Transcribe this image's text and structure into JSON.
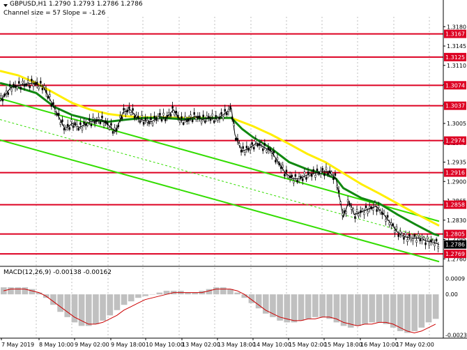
{
  "header": {
    "symbol_line": "GBPUSD,H1  1.2790 1.2793 1.2786 1.2786",
    "channel_line": "Channel size = 57 Slope = -1.26"
  },
  "colors": {
    "level_line": "#dd0022",
    "level_label_bg": "#dd0022",
    "price_label_bg": "#000000",
    "channel": "#33dd00",
    "ma_fast": "#118811",
    "ma_slow": "#ffee00",
    "candle": "#000000",
    "histogram": "#c0c0c0",
    "macd_signal": "#cc0000",
    "envelope": "#cc66cc"
  },
  "chart_data": {
    "type": "candlestick",
    "title": "GBPUSD,H1",
    "ylim": [
      1.2749,
      1.3198
    ],
    "y_ticks": [
      "1.3180",
      "1.3145",
      "1.3110",
      "1.3075",
      "1.3040",
      "1.3005",
      "1.2970",
      "1.2935",
      "1.2900",
      "1.2865",
      "1.2830",
      "1.2795",
      "1.2760"
    ],
    "x_labels": [
      "7 May 2019",
      "8 May 10:00",
      "9 May 02:00",
      "9 May 18:00",
      "10 May 10:00",
      "13 May 02:00",
      "13 May 18:00",
      "14 May 10:00",
      "15 May 02:00",
      "15 May 18:00",
      "16 May 10:00",
      "17 May 02:00"
    ],
    "levels": [
      {
        "value": 1.3167,
        "label": "1.3167"
      },
      {
        "value": 1.3125,
        "label": "1.3125"
      },
      {
        "value": 1.3074,
        "label": "1.3074"
      },
      {
        "value": 1.3037,
        "label": "1.3037"
      },
      {
        "value": 1.2974,
        "label": "1.2974"
      },
      {
        "value": 1.2916,
        "label": "1.2916"
      },
      {
        "value": 1.2858,
        "label": "1.2858"
      },
      {
        "value": 1.2805,
        "label": "1.2805"
      },
      {
        "value": 1.2769,
        "label": "1.2769"
      }
    ],
    "current_price": {
      "value": 1.2786,
      "label": "1.2786"
    },
    "price_path": [
      [
        0,
        1.3045
      ],
      [
        6,
        1.307
      ],
      [
        12,
        1.3075
      ],
      [
        18,
        1.3078
      ],
      [
        24,
        1.3072
      ],
      [
        29,
        1.304
      ],
      [
        32,
        1.302
      ],
      [
        36,
        1.2995
      ],
      [
        40,
        1.3005
      ],
      [
        44,
        1.2998
      ],
      [
        50,
        1.3008
      ],
      [
        56,
        1.3012
      ],
      [
        60,
        1.3002
      ],
      [
        64,
        1.299
      ],
      [
        68,
        1.3025
      ],
      [
        72,
        1.303
      ],
      [
        76,
        1.3015
      ],
      [
        80,
        1.301
      ],
      [
        84,
        1.3008
      ],
      [
        88,
        1.3018
      ],
      [
        92,
        1.3015
      ],
      [
        96,
        1.303
      ],
      [
        100,
        1.301
      ],
      [
        104,
        1.3012
      ],
      [
        108,
        1.3018
      ],
      [
        112,
        1.3012
      ],
      [
        116,
        1.3016
      ],
      [
        120,
        1.3013
      ],
      [
        124,
        1.3022
      ],
      [
        128,
        1.3032
      ],
      [
        130,
        1.2985
      ],
      [
        134,
        1.2955
      ],
      [
        138,
        1.296
      ],
      [
        142,
        1.297
      ],
      [
        146,
        1.2962
      ],
      [
        150,
        1.2955
      ],
      [
        154,
        1.2935
      ],
      [
        158,
        1.2915
      ],
      [
        162,
        1.2905
      ],
      [
        166,
        1.2905
      ],
      [
        170,
        1.2912
      ],
      [
        174,
        1.2915
      ],
      [
        178,
        1.2918
      ],
      [
        182,
        1.2918
      ],
      [
        186,
        1.2905
      ],
      [
        188,
        1.287
      ],
      [
        190,
        1.2835
      ],
      [
        193,
        1.2865
      ],
      [
        196,
        1.284
      ],
      [
        200,
        1.2845
      ],
      [
        204,
        1.285
      ],
      [
        208,
        1.2855
      ],
      [
        212,
        1.2842
      ],
      [
        216,
        1.2825
      ],
      [
        220,
        1.2808
      ],
      [
        224,
        1.28
      ],
      [
        228,
        1.2797
      ],
      [
        232,
        1.2798
      ],
      [
        236,
        1.2792
      ],
      [
        240,
        1.279
      ],
      [
        243,
        1.2786
      ]
    ],
    "ma_fast": [
      [
        0,
        1.3078
      ],
      [
        10,
        1.307
      ],
      [
        20,
        1.306
      ],
      [
        30,
        1.3035
      ],
      [
        40,
        1.302
      ],
      [
        50,
        1.3012
      ],
      [
        60,
        1.3008
      ],
      [
        70,
        1.3012
      ],
      [
        80,
        1.3015
      ],
      [
        90,
        1.3015
      ],
      [
        100,
        1.3013
      ],
      [
        110,
        1.3014
      ],
      [
        120,
        1.3015
      ],
      [
        128,
        1.3015
      ],
      [
        134,
        1.2995
      ],
      [
        140,
        1.298
      ],
      [
        150,
        1.296
      ],
      [
        160,
        1.2935
      ],
      [
        170,
        1.2922
      ],
      [
        180,
        1.2913
      ],
      [
        186,
        1.2905
      ],
      [
        190,
        1.2888
      ],
      [
        200,
        1.287
      ],
      [
        210,
        1.286
      ],
      [
        220,
        1.284
      ],
      [
        230,
        1.2822
      ],
      [
        240,
        1.2805
      ],
      [
        243,
        1.2802
      ]
    ],
    "ma_slow": [
      [
        0,
        1.31
      ],
      [
        10,
        1.3092
      ],
      [
        20,
        1.3078
      ],
      [
        30,
        1.306
      ],
      [
        40,
        1.3042
      ],
      [
        50,
        1.303
      ],
      [
        60,
        1.3022
      ],
      [
        70,
        1.3018
      ],
      [
        80,
        1.3016
      ],
      [
        90,
        1.3016
      ],
      [
        100,
        1.3015
      ],
      [
        110,
        1.3015
      ],
      [
        120,
        1.3015
      ],
      [
        128,
        1.3015
      ],
      [
        140,
        1.3
      ],
      [
        150,
        1.2985
      ],
      [
        160,
        1.2968
      ],
      [
        170,
        1.295
      ],
      [
        180,
        1.2935
      ],
      [
        190,
        1.2915
      ],
      [
        200,
        1.2895
      ],
      [
        210,
        1.2878
      ],
      [
        220,
        1.286
      ],
      [
        230,
        1.2842
      ],
      [
        243,
        1.282
      ]
    ],
    "channel_lines": [
      {
        "name": "upper",
        "points": [
          [
            0,
            1.305
          ],
          [
            243,
            1.2828
          ]
        ]
      },
      {
        "name": "lower",
        "points": [
          [
            0,
            1.2975
          ],
          [
            243,
            1.2755
          ]
        ]
      },
      {
        "name": "middle",
        "points": [
          [
            0,
            1.3012
          ],
          [
            243,
            1.2792
          ]
        ],
        "dashed": true
      }
    ],
    "macd": {
      "label": "MACD(12,26,9) -0.00138 -0.00162",
      "ylim": [
        -0.0025,
        0.0012
      ],
      "y_ticks": [
        "0.0009",
        "0.00",
        "-0.00232"
      ],
      "histogram": [
        0.0004,
        0.0004,
        0.0004,
        0.0004,
        0.0003,
        0.0001,
        -0.0002,
        -0.0006,
        -0.001,
        -0.0013,
        -0.0016,
        -0.0018,
        -0.0018,
        -0.0017,
        -0.0015,
        -0.0012,
        -0.0009,
        -0.0006,
        -0.0004,
        -0.0002,
        -0.0001,
        0.0,
        0.0001,
        0.0002,
        0.0002,
        0.0002,
        0.0001,
        0.0001,
        0.0002,
        0.0003,
        0.0004,
        0.0004,
        0.0003,
        0.0001,
        -0.0002,
        -0.0005,
        -0.0008,
        -0.0011,
        -0.0013,
        -0.0015,
        -0.0016,
        -0.0016,
        -0.0015,
        -0.0014,
        -0.0013,
        -0.0013,
        -0.0014,
        -0.0016,
        -0.0018,
        -0.0019,
        -0.0018,
        -0.0017,
        -0.0016,
        -0.0016,
        -0.0017,
        -0.0019,
        -0.0021,
        -0.0022,
        -0.0021,
        -0.0019,
        -0.0016,
        -0.0014
      ],
      "signal": [
        0.0002,
        0.0003,
        0.0003,
        0.0003,
        0.0002,
        0.0001,
        -0.0001,
        -0.0004,
        -0.0007,
        -0.001,
        -0.0013,
        -0.0015,
        -0.0017,
        -0.0017,
        -0.0016,
        -0.0014,
        -0.0012,
        -0.0009,
        -0.0007,
        -0.0005,
        -0.0003,
        -0.0002,
        -0.0001,
        0.0,
        0.0001,
        0.0001,
        0.0001,
        0.0001,
        0.0001,
        0.0002,
        0.0003,
        0.0003,
        0.0003,
        0.0002,
        0.0,
        -0.0003,
        -0.0006,
        -0.0009,
        -0.0011,
        -0.0013,
        -0.0014,
        -0.0015,
        -0.0015,
        -0.0014,
        -0.0014,
        -0.0013,
        -0.0013,
        -0.0014,
        -0.0016,
        -0.0017,
        -0.0018,
        -0.0017,
        -0.0017,
        -0.0016,
        -0.0016,
        -0.0017,
        -0.0019,
        -0.0021,
        -0.0022,
        -0.0021,
        -0.0019,
        -0.0017
      ]
    }
  }
}
